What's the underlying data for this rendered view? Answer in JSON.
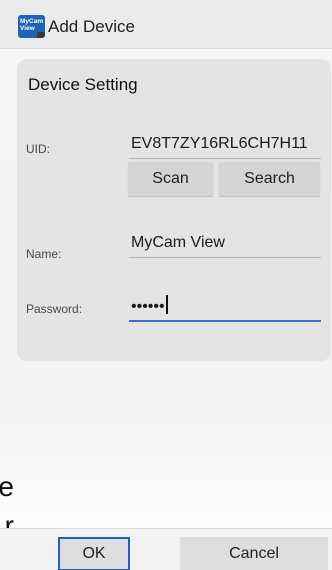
{
  "window": {
    "title": "Add Device",
    "icon_text": [
      "MyCam",
      "View"
    ]
  },
  "device_setting": {
    "heading": "Device Setting",
    "uid": {
      "label": "UID:",
      "value": "EV8T7ZY16RL6CH7H11"
    },
    "scan_label": "Scan",
    "search_label": "Search",
    "name": {
      "label": "Name:",
      "value": "MyCam View"
    },
    "password": {
      "label": "Password:",
      "value": "••••••"
    }
  },
  "dialog_buttons": {
    "ok_label": "OK",
    "cancel_label": "Cancel"
  },
  "background_fragments": {
    "line1": "e",
    "line2": "r"
  },
  "colors": {
    "accent_focus": "#3a70c8",
    "ok_outline": "#1f5fc7",
    "icon_blue": "#1f63b8"
  }
}
